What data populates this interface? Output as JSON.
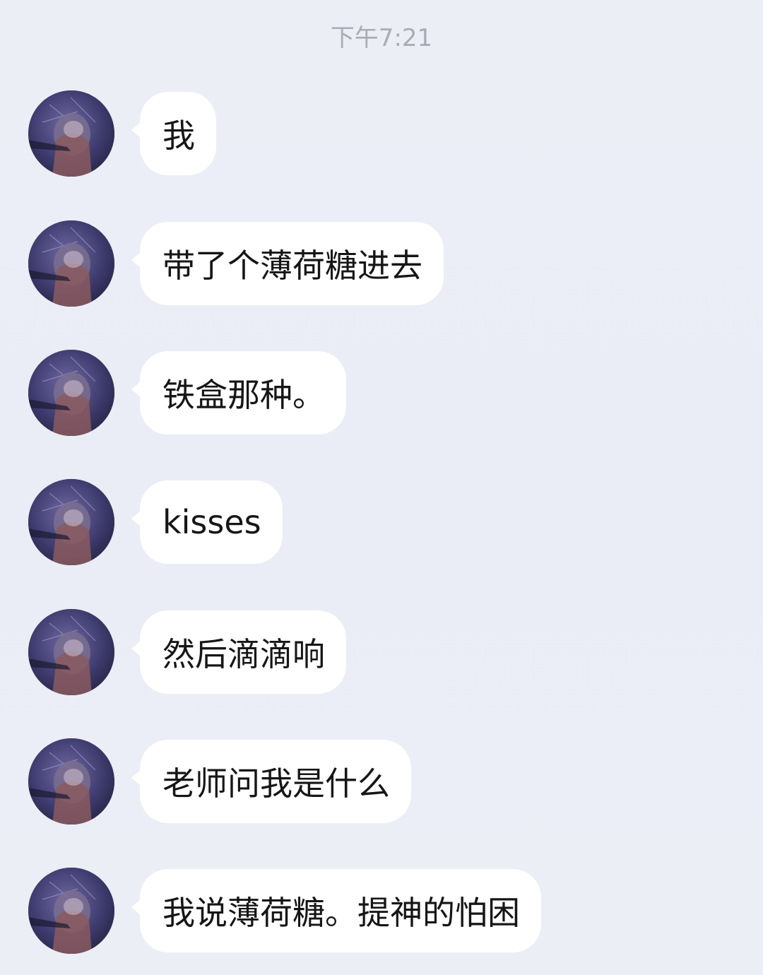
{
  "status": {
    "time": "下午7:21"
  },
  "colors": {
    "background": "#eceef5",
    "bubble": "#ffffff",
    "text": "#161616",
    "timestamp": "#a9acb4"
  },
  "messages": [
    {
      "text": "我",
      "avatar_icon": "anime-avatar-icon"
    },
    {
      "text": "带了个薄荷糖进去",
      "avatar_icon": "anime-avatar-icon"
    },
    {
      "text": "铁盒那种。",
      "avatar_icon": "anime-avatar-icon"
    },
    {
      "text": "kisses",
      "avatar_icon": "anime-avatar-icon"
    },
    {
      "text": "然后滴滴响",
      "avatar_icon": "anime-avatar-icon"
    },
    {
      "text": "老师问我是什么",
      "avatar_icon": "anime-avatar-icon"
    },
    {
      "text": "我说薄荷糖。提神的怕困",
      "avatar_icon": "anime-avatar-icon"
    }
  ]
}
